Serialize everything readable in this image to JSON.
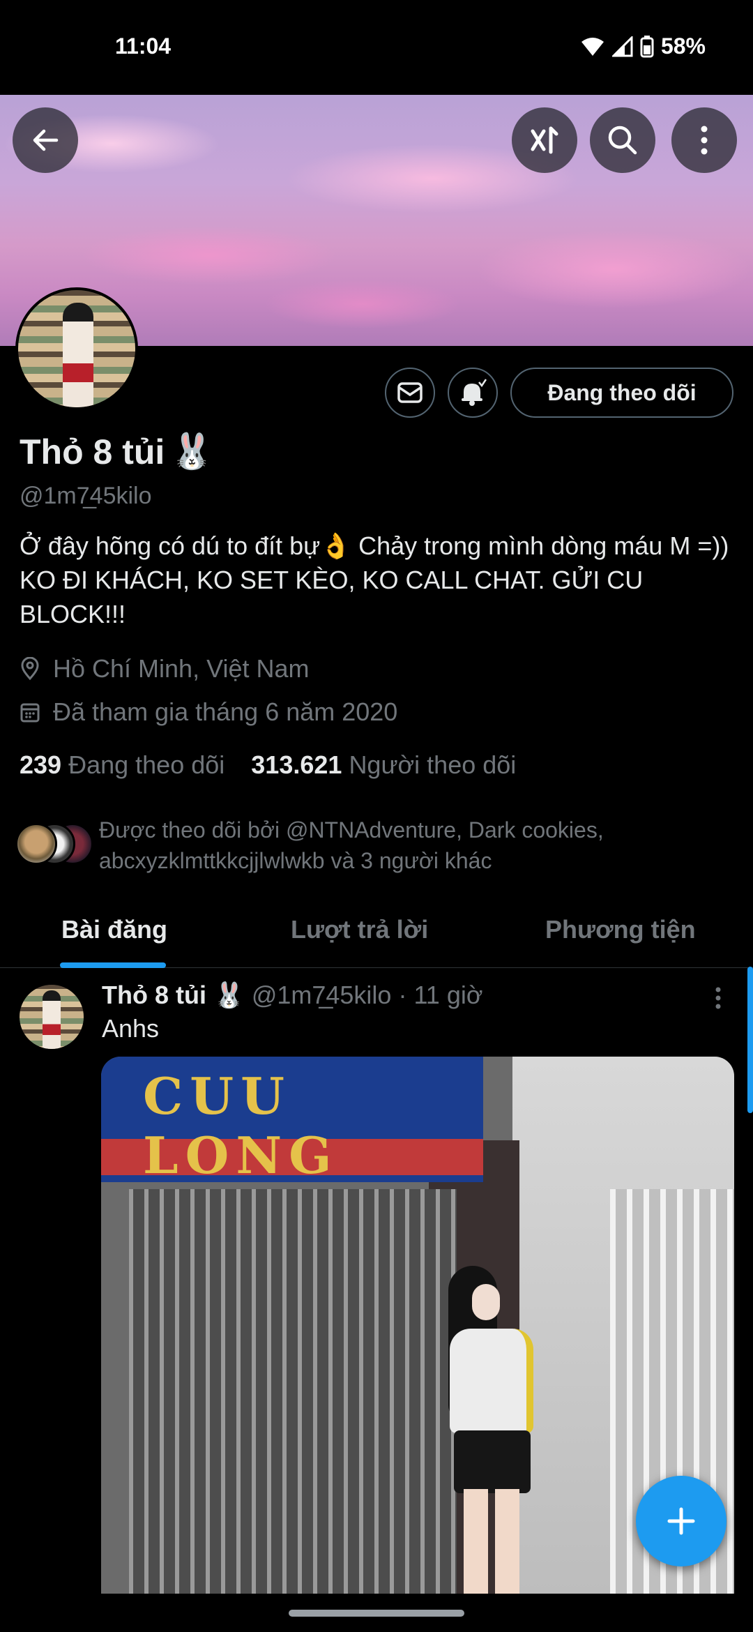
{
  "status_bar": {
    "time": "11:04",
    "battery": "58%"
  },
  "header": {
    "back_icon": "arrow-left-icon",
    "grok_icon": "grok-icon",
    "search_icon": "search-icon",
    "more_icon": "more-vertical-icon"
  },
  "profile": {
    "display_name": "Thỏ 8 tủi",
    "name_emoji": "🐰",
    "handle": "@1m7̲45kilo",
    "bio": "Ở đây hõng có dú to đít bự👌 Chảy trong mình dòng máu M =)) KO ĐI KHÁCH, KO SET KÈO, KO CALL CHAT. GỬI CU BLOCK!!!",
    "location": "Hồ Chí Minh, Việt Nam",
    "joined": "Đã tham gia tháng 6 năm 2020",
    "following_count": "239",
    "following_label": "Đang theo dõi",
    "followers_count": "313.621",
    "followers_label": "Người theo dõi",
    "followed_by": "Được theo dõi bởi @NTNAdventure, Dark cookies, abcxyzklmttkkcjjlwlwkb và 3 người khác",
    "follow_button": "Đang theo dõi"
  },
  "tabs": [
    {
      "label": "Bài đăng",
      "active": true
    },
    {
      "label": "Lượt trả lời",
      "active": false
    },
    {
      "label": "Phương tiện",
      "active": false
    }
  ],
  "post": {
    "name": "Thỏ 8 tủi",
    "emoji": "🐰",
    "meta": "@1m7̲45kilo · 11 giờ",
    "text": "Anhs",
    "media_sign": "CUU LONG"
  },
  "colors": {
    "accent": "#1d9bf0",
    "muted": "#71767b",
    "text": "#e7e9ea",
    "border": "#2f3336"
  }
}
